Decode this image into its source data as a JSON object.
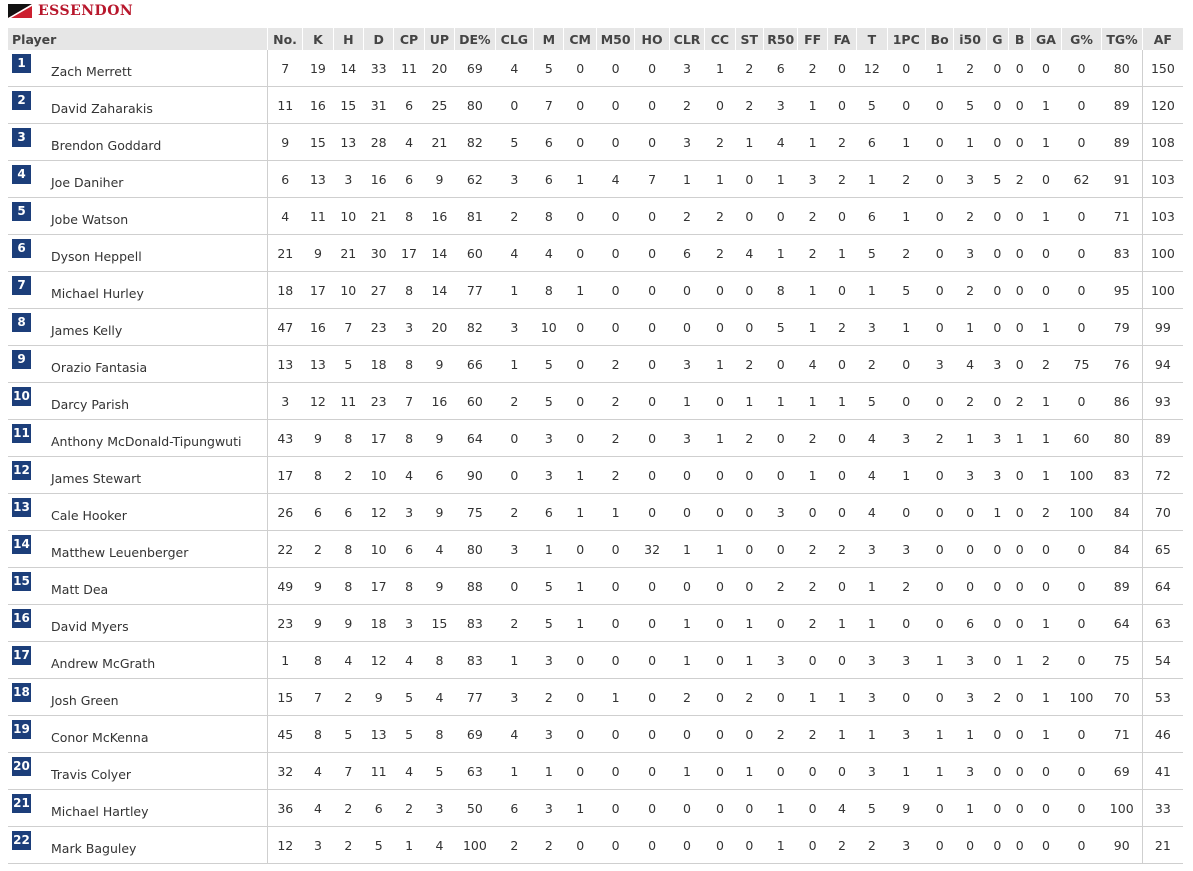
{
  "team": {
    "name": "ESSENDON",
    "colors": {
      "red": "#cc1f2f",
      "black": "#111111"
    }
  },
  "columns": [
    "Player",
    "No.",
    "K",
    "H",
    "D",
    "CP",
    "UP",
    "DE%",
    "CLG",
    "M",
    "CM",
    "M50",
    "HO",
    "CLR",
    "CC",
    "ST",
    "R50",
    "FF",
    "FA",
    "T",
    "1PC",
    "Bo",
    "i50",
    "G",
    "B",
    "GA",
    "G%",
    "TG%",
    "AF"
  ],
  "rows": [
    {
      "rank": "1",
      "name": "Zach Merrett",
      "stats": [
        "7",
        "19",
        "14",
        "33",
        "11",
        "20",
        "69",
        "4",
        "5",
        "0",
        "0",
        "0",
        "3",
        "1",
        "2",
        "6",
        "2",
        "0",
        "12",
        "0",
        "1",
        "2",
        "0",
        "0",
        "0",
        "0",
        "80",
        "150"
      ]
    },
    {
      "rank": "2",
      "name": "David Zaharakis",
      "stats": [
        "11",
        "16",
        "15",
        "31",
        "6",
        "25",
        "80",
        "0",
        "7",
        "0",
        "0",
        "0",
        "2",
        "0",
        "2",
        "3",
        "1",
        "0",
        "5",
        "0",
        "0",
        "5",
        "0",
        "0",
        "1",
        "0",
        "89",
        "120"
      ]
    },
    {
      "rank": "3",
      "name": "Brendon Goddard",
      "stats": [
        "9",
        "15",
        "13",
        "28",
        "4",
        "21",
        "82",
        "5",
        "6",
        "0",
        "0",
        "0",
        "3",
        "2",
        "1",
        "4",
        "1",
        "2",
        "6",
        "1",
        "0",
        "1",
        "0",
        "0",
        "1",
        "0",
        "89",
        "108"
      ]
    },
    {
      "rank": "4",
      "name": "Joe Daniher",
      "stats": [
        "6",
        "13",
        "3",
        "16",
        "6",
        "9",
        "62",
        "3",
        "6",
        "1",
        "4",
        "7",
        "1",
        "1",
        "0",
        "1",
        "3",
        "2",
        "1",
        "2",
        "0",
        "3",
        "5",
        "2",
        "0",
        "62",
        "91",
        "103"
      ]
    },
    {
      "rank": "5",
      "name": "Jobe Watson",
      "stats": [
        "4",
        "11",
        "10",
        "21",
        "8",
        "16",
        "81",
        "2",
        "8",
        "0",
        "0",
        "0",
        "2",
        "2",
        "0",
        "0",
        "2",
        "0",
        "6",
        "1",
        "0",
        "2",
        "0",
        "0",
        "1",
        "0",
        "71",
        "103"
      ]
    },
    {
      "rank": "6",
      "name": "Dyson Heppell",
      "stats": [
        "21",
        "9",
        "21",
        "30",
        "17",
        "14",
        "60",
        "4",
        "4",
        "0",
        "0",
        "0",
        "6",
        "2",
        "4",
        "1",
        "2",
        "1",
        "5",
        "2",
        "0",
        "3",
        "0",
        "0",
        "0",
        "0",
        "83",
        "100"
      ]
    },
    {
      "rank": "7",
      "name": "Michael Hurley",
      "stats": [
        "18",
        "17",
        "10",
        "27",
        "8",
        "14",
        "77",
        "1",
        "8",
        "1",
        "0",
        "0",
        "0",
        "0",
        "0",
        "8",
        "1",
        "0",
        "1",
        "5",
        "0",
        "2",
        "0",
        "0",
        "0",
        "0",
        "95",
        "100"
      ]
    },
    {
      "rank": "8",
      "name": "James Kelly",
      "stats": [
        "47",
        "16",
        "7",
        "23",
        "3",
        "20",
        "82",
        "3",
        "10",
        "0",
        "0",
        "0",
        "0",
        "0",
        "0",
        "5",
        "1",
        "2",
        "3",
        "1",
        "0",
        "1",
        "0",
        "0",
        "1",
        "0",
        "79",
        "99"
      ]
    },
    {
      "rank": "9",
      "name": "Orazio Fantasia",
      "stats": [
        "13",
        "13",
        "5",
        "18",
        "8",
        "9",
        "66",
        "1",
        "5",
        "0",
        "2",
        "0",
        "3",
        "1",
        "2",
        "0",
        "4",
        "0",
        "2",
        "0",
        "3",
        "4",
        "3",
        "0",
        "2",
        "75",
        "76",
        "94"
      ]
    },
    {
      "rank": "10",
      "name": "Darcy Parish",
      "stats": [
        "3",
        "12",
        "11",
        "23",
        "7",
        "16",
        "60",
        "2",
        "5",
        "0",
        "2",
        "0",
        "1",
        "0",
        "1",
        "1",
        "1",
        "1",
        "5",
        "0",
        "0",
        "2",
        "0",
        "2",
        "1",
        "0",
        "86",
        "93"
      ]
    },
    {
      "rank": "11",
      "name": "Anthony McDonald-Tipungwuti",
      "stats": [
        "43",
        "9",
        "8",
        "17",
        "8",
        "9",
        "64",
        "0",
        "3",
        "0",
        "2",
        "0",
        "3",
        "1",
        "2",
        "0",
        "2",
        "0",
        "4",
        "3",
        "2",
        "1",
        "3",
        "1",
        "1",
        "60",
        "80",
        "89"
      ]
    },
    {
      "rank": "12",
      "name": "James Stewart",
      "stats": [
        "17",
        "8",
        "2",
        "10",
        "4",
        "6",
        "90",
        "0",
        "3",
        "1",
        "2",
        "0",
        "0",
        "0",
        "0",
        "0",
        "1",
        "0",
        "4",
        "1",
        "0",
        "3",
        "3",
        "0",
        "1",
        "100",
        "83",
        "72"
      ]
    },
    {
      "rank": "13",
      "name": "Cale Hooker",
      "stats": [
        "26",
        "6",
        "6",
        "12",
        "3",
        "9",
        "75",
        "2",
        "6",
        "1",
        "1",
        "0",
        "0",
        "0",
        "0",
        "3",
        "0",
        "0",
        "4",
        "0",
        "0",
        "0",
        "1",
        "0",
        "2",
        "100",
        "84",
        "70"
      ]
    },
    {
      "rank": "14",
      "name": "Matthew Leuenberger",
      "stats": [
        "22",
        "2",
        "8",
        "10",
        "6",
        "4",
        "80",
        "3",
        "1",
        "0",
        "0",
        "32",
        "1",
        "1",
        "0",
        "0",
        "2",
        "2",
        "3",
        "3",
        "0",
        "0",
        "0",
        "0",
        "0",
        "0",
        "84",
        "65"
      ]
    },
    {
      "rank": "15",
      "name": "Matt Dea",
      "stats": [
        "49",
        "9",
        "8",
        "17",
        "8",
        "9",
        "88",
        "0",
        "5",
        "1",
        "0",
        "0",
        "0",
        "0",
        "0",
        "2",
        "2",
        "0",
        "1",
        "2",
        "0",
        "0",
        "0",
        "0",
        "0",
        "0",
        "89",
        "64"
      ]
    },
    {
      "rank": "16",
      "name": "David Myers",
      "stats": [
        "23",
        "9",
        "9",
        "18",
        "3",
        "15",
        "83",
        "2",
        "5",
        "1",
        "0",
        "0",
        "1",
        "0",
        "1",
        "0",
        "2",
        "1",
        "1",
        "0",
        "0",
        "6",
        "0",
        "0",
        "1",
        "0",
        "64",
        "63"
      ]
    },
    {
      "rank": "17",
      "name": "Andrew McGrath",
      "stats": [
        "1",
        "8",
        "4",
        "12",
        "4",
        "8",
        "83",
        "1",
        "3",
        "0",
        "0",
        "0",
        "1",
        "0",
        "1",
        "3",
        "0",
        "0",
        "3",
        "3",
        "1",
        "3",
        "0",
        "1",
        "2",
        "0",
        "75",
        "54"
      ]
    },
    {
      "rank": "18",
      "name": "Josh Green",
      "stats": [
        "15",
        "7",
        "2",
        "9",
        "5",
        "4",
        "77",
        "3",
        "2",
        "0",
        "1",
        "0",
        "2",
        "0",
        "2",
        "0",
        "1",
        "1",
        "3",
        "0",
        "0",
        "3",
        "2",
        "0",
        "1",
        "100",
        "70",
        "53"
      ]
    },
    {
      "rank": "19",
      "name": "Conor McKenna",
      "stats": [
        "45",
        "8",
        "5",
        "13",
        "5",
        "8",
        "69",
        "4",
        "3",
        "0",
        "0",
        "0",
        "0",
        "0",
        "0",
        "2",
        "2",
        "1",
        "1",
        "3",
        "1",
        "1",
        "0",
        "0",
        "1",
        "0",
        "71",
        "46"
      ]
    },
    {
      "rank": "20",
      "name": "Travis Colyer",
      "stats": [
        "32",
        "4",
        "7",
        "11",
        "4",
        "5",
        "63",
        "1",
        "1",
        "0",
        "0",
        "0",
        "1",
        "0",
        "1",
        "0",
        "0",
        "0",
        "3",
        "1",
        "1",
        "3",
        "0",
        "0",
        "0",
        "0",
        "69",
        "41"
      ]
    },
    {
      "rank": "21",
      "name": "Michael Hartley",
      "stats": [
        "36",
        "4",
        "2",
        "6",
        "2",
        "3",
        "50",
        "6",
        "3",
        "1",
        "0",
        "0",
        "0",
        "0",
        "0",
        "1",
        "0",
        "4",
        "5",
        "9",
        "0",
        "1",
        "0",
        "0",
        "0",
        "0",
        "100",
        "33"
      ]
    },
    {
      "rank": "22",
      "name": "Mark Baguley",
      "stats": [
        "12",
        "3",
        "2",
        "5",
        "1",
        "4",
        "100",
        "2",
        "2",
        "0",
        "0",
        "0",
        "0",
        "0",
        "0",
        "1",
        "0",
        "2",
        "2",
        "3",
        "0",
        "0",
        "0",
        "0",
        "0",
        "0",
        "90",
        "21"
      ]
    }
  ]
}
